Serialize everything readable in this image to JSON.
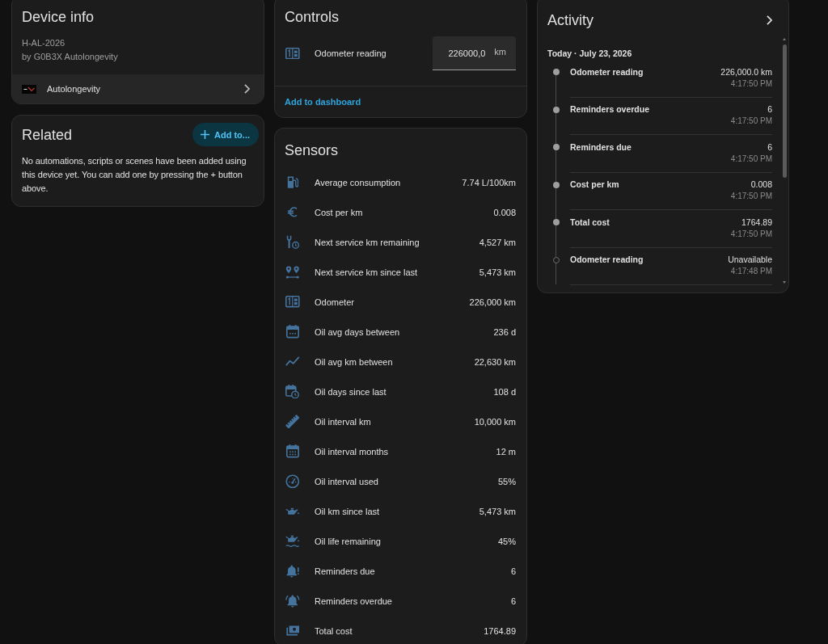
{
  "device_info": {
    "title": "Device info",
    "model": "H-AL-2026",
    "manufacturer": "by G0B3X Autolongevity",
    "integration": "Autolongevity"
  },
  "related": {
    "title": "Related",
    "add_button": "Add to...",
    "message": "No automations, scripts or scenes have been added using this device yet. You can add one by pressing the + button above."
  },
  "controls": {
    "title": "Controls",
    "entities": [
      {
        "name": "Odometer reading",
        "value": "226000,0",
        "unit": "km"
      }
    ],
    "footer_link": "Add to dashboard"
  },
  "sensors": {
    "title": "Sensors",
    "entities": [
      {
        "name": "Average consumption",
        "value": "7.74 L/100km"
      },
      {
        "name": "Cost per km",
        "value": "0.008"
      },
      {
        "name": "Next service km remaining",
        "value": "4,527 km"
      },
      {
        "name": "Next service km since last",
        "value": "5,473 km"
      },
      {
        "name": "Odometer",
        "value": "226,000 km"
      },
      {
        "name": "Oil avg days between",
        "value": "236 d"
      },
      {
        "name": "Oil avg km between",
        "value": "22,630 km"
      },
      {
        "name": "Oil days since last",
        "value": "108 d"
      },
      {
        "name": "Oil interval km",
        "value": "10,000 km"
      },
      {
        "name": "Oil interval months",
        "value": "12 m"
      },
      {
        "name": "Oil interval used",
        "value": "55%"
      },
      {
        "name": "Oil km since last",
        "value": "5,473 km"
      },
      {
        "name": "Oil life remaining",
        "value": "45%"
      },
      {
        "name": "Reminders due",
        "value": "6"
      },
      {
        "name": "Reminders overdue",
        "value": "6"
      },
      {
        "name": "Total cost",
        "value": "1764.89"
      }
    ]
  },
  "activity": {
    "title": "Activity",
    "date_heading": "Today · July 23, 2026",
    "entries": [
      {
        "name": "Odometer reading",
        "value": "226,000.0 km",
        "time": "4:17:50 PM",
        "available": true
      },
      {
        "name": "Reminders overdue",
        "value": "6",
        "time": "4:17:50 PM",
        "available": true
      },
      {
        "name": "Reminders due",
        "value": "6",
        "time": "4:17:50 PM",
        "available": true
      },
      {
        "name": "Cost per km",
        "value": "0.008",
        "time": "4:17:50 PM",
        "available": true
      },
      {
        "name": "Total cost",
        "value": "1764.89",
        "time": "4:17:50 PM",
        "available": true
      },
      {
        "name": "Odometer reading",
        "value": "Unavailable",
        "time": "4:17:48 PM",
        "available": false
      }
    ]
  }
}
